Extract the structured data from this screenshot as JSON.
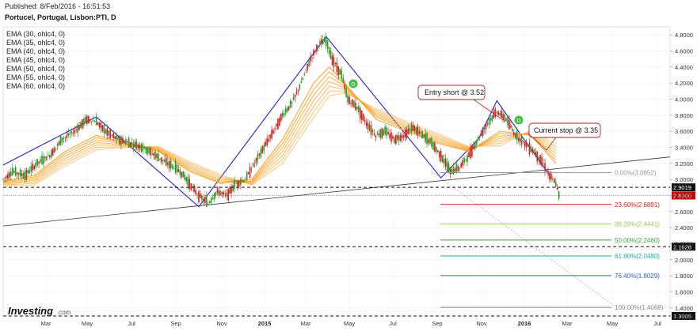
{
  "header": {
    "published": "Published: 8/Feb/2016 - 16:51:53",
    "instrument": "Portucel, Portugal, Lisbon:PTI, D"
  },
  "legend": [
    "EMA (30, ohlc4, 0)",
    "EMA (35, ohlc4, 0)",
    "EMA (40, ohlc4, 0)",
    "EMA (45, ohlc4, 0)",
    "EMA (50, ohlc4, 0)",
    "EMA (55, ohlc4, 0)",
    "EMA (60, ohlc4, 0)"
  ],
  "logo": {
    "main": "Investing",
    "suffix": ".com"
  },
  "colors": {
    "up_candle": "#2a9a2a",
    "down_candle": "#cc2222",
    "ema": "#f5a020",
    "trend_line": "#2222cc",
    "support_line": "#333333",
    "price_tag": "#cc0000",
    "level_tag": "#111111",
    "marker": "#44bb44"
  },
  "chart_data": {
    "type": "candlestick",
    "title": "Portucel, Portugal, Lisbon:PTI, D",
    "y_range": [
      1.3,
      4.9
    ],
    "y_ticks": [
      "4.8000",
      "4.6000",
      "4.4000",
      "4.2000",
      "4.0000",
      "3.8000",
      "3.6000",
      "3.4000",
      "3.2000",
      "3.0000",
      "2.8000",
      "2.6000",
      "2.4000",
      "2.2000",
      "2.0000",
      "1.8000",
      "1.6000",
      "1.4000",
      "1.3000"
    ],
    "x_ticks": [
      {
        "label": "Mar",
        "bold": false
      },
      {
        "label": "May",
        "bold": false
      },
      {
        "label": "Jul",
        "bold": false
      },
      {
        "label": "Sep",
        "bold": false
      },
      {
        "label": "Nov",
        "bold": false
      },
      {
        "label": "2015",
        "bold": true
      },
      {
        "label": "Mar",
        "bold": false
      },
      {
        "label": "May",
        "bold": false
      },
      {
        "label": "Jul",
        "bold": false
      },
      {
        "label": "Sep",
        "bold": false
      },
      {
        "label": "Nov",
        "bold": false
      },
      {
        "label": "2016",
        "bold": true
      },
      {
        "label": "Mar",
        "bold": false
      },
      {
        "label": "May",
        "bold": false
      },
      {
        "label": "Jul",
        "bold": false
      }
    ],
    "price_path": [
      [
        0,
        3.0
      ],
      [
        6,
        3.1
      ],
      [
        14,
        3.05
      ],
      [
        22,
        3.2
      ],
      [
        30,
        3.3
      ],
      [
        38,
        3.5
      ],
      [
        46,
        3.6
      ],
      [
        54,
        3.75
      ],
      [
        60,
        3.72
      ],
      [
        66,
        3.6
      ],
      [
        74,
        3.5
      ],
      [
        82,
        3.45
      ],
      [
        90,
        3.4
      ],
      [
        98,
        3.3
      ],
      [
        106,
        3.2
      ],
      [
        114,
        3.1
      ],
      [
        120,
        2.95
      ],
      [
        126,
        2.8
      ],
      [
        132,
        2.7
      ],
      [
        138,
        2.85
      ],
      [
        144,
        2.8
      ],
      [
        150,
        2.95
      ],
      [
        156,
        3.0
      ],
      [
        162,
        3.2
      ],
      [
        168,
        3.4
      ],
      [
        174,
        3.6
      ],
      [
        180,
        3.8
      ],
      [
        186,
        3.95
      ],
      [
        192,
        4.2
      ],
      [
        198,
        4.5
      ],
      [
        204,
        4.7
      ],
      [
        208,
        4.72
      ],
      [
        212,
        4.5
      ],
      [
        218,
        4.3
      ],
      [
        222,
        4.0
      ],
      [
        228,
        3.9
      ],
      [
        234,
        3.7
      ],
      [
        240,
        3.55
      ],
      [
        246,
        3.6
      ],
      [
        252,
        3.5
      ],
      [
        258,
        3.55
      ],
      [
        264,
        3.65
      ],
      [
        270,
        3.55
      ],
      [
        276,
        3.45
      ],
      [
        282,
        3.3
      ],
      [
        288,
        3.1
      ],
      [
        294,
        3.15
      ],
      [
        300,
        3.3
      ],
      [
        306,
        3.5
      ],
      [
        312,
        3.7
      ],
      [
        318,
        3.85
      ],
      [
        324,
        3.75
      ],
      [
        330,
        3.55
      ],
      [
        336,
        3.45
      ],
      [
        342,
        3.35
      ],
      [
        348,
        3.2
      ],
      [
        352,
        3.05
      ],
      [
        356,
        2.95
      ],
      [
        358,
        2.8
      ]
    ],
    "ema_series": [
      {
        "values": [
          [
            0,
            2.98
          ],
          [
            20,
            3.05
          ],
          [
            40,
            3.35
          ],
          [
            60,
            3.55
          ],
          [
            80,
            3.45
          ],
          [
            100,
            3.35
          ],
          [
            120,
            3.1
          ],
          [
            140,
            2.95
          ],
          [
            160,
            3.0
          ],
          [
            180,
            3.5
          ],
          [
            200,
            4.2
          ],
          [
            210,
            4.4
          ],
          [
            220,
            4.2
          ],
          [
            240,
            3.75
          ],
          [
            260,
            3.6
          ],
          [
            280,
            3.45
          ],
          [
            300,
            3.35
          ],
          [
            320,
            3.6
          ],
          [
            340,
            3.55
          ],
          [
            356,
            3.2
          ]
        ]
      },
      {
        "values": [
          [
            0,
            2.97
          ],
          [
            20,
            3.03
          ],
          [
            40,
            3.32
          ],
          [
            60,
            3.52
          ],
          [
            80,
            3.45
          ],
          [
            100,
            3.36
          ],
          [
            120,
            3.12
          ],
          [
            140,
            2.96
          ],
          [
            160,
            2.98
          ],
          [
            180,
            3.45
          ],
          [
            200,
            4.12
          ],
          [
            210,
            4.34
          ],
          [
            220,
            4.18
          ],
          [
            240,
            3.78
          ],
          [
            260,
            3.62
          ],
          [
            280,
            3.47
          ],
          [
            300,
            3.36
          ],
          [
            320,
            3.57
          ],
          [
            340,
            3.56
          ],
          [
            356,
            3.24
          ]
        ]
      },
      {
        "values": [
          [
            0,
            2.96
          ],
          [
            20,
            3.01
          ],
          [
            40,
            3.29
          ],
          [
            60,
            3.49
          ],
          [
            80,
            3.44
          ],
          [
            100,
            3.37
          ],
          [
            120,
            3.14
          ],
          [
            140,
            2.98
          ],
          [
            160,
            2.97
          ],
          [
            180,
            3.4
          ],
          [
            200,
            4.05
          ],
          [
            210,
            4.28
          ],
          [
            220,
            4.16
          ],
          [
            240,
            3.8
          ],
          [
            260,
            3.64
          ],
          [
            280,
            3.49
          ],
          [
            300,
            3.37
          ],
          [
            320,
            3.54
          ],
          [
            340,
            3.57
          ],
          [
            356,
            3.28
          ]
        ]
      },
      {
        "values": [
          [
            0,
            2.95
          ],
          [
            20,
            2.99
          ],
          [
            40,
            3.26
          ],
          [
            60,
            3.46
          ],
          [
            80,
            3.43
          ],
          [
            100,
            3.38
          ],
          [
            120,
            3.16
          ],
          [
            140,
            3.0
          ],
          [
            160,
            2.96
          ],
          [
            180,
            3.35
          ],
          [
            200,
            3.98
          ],
          [
            210,
            4.22
          ],
          [
            220,
            4.14
          ],
          [
            240,
            3.82
          ],
          [
            260,
            3.66
          ],
          [
            280,
            3.51
          ],
          [
            300,
            3.38
          ],
          [
            320,
            3.51
          ],
          [
            340,
            3.58
          ],
          [
            356,
            3.32
          ]
        ]
      },
      {
        "values": [
          [
            0,
            2.94
          ],
          [
            20,
            2.97
          ],
          [
            40,
            3.23
          ],
          [
            60,
            3.43
          ],
          [
            80,
            3.42
          ],
          [
            100,
            3.39
          ],
          [
            120,
            3.18
          ],
          [
            140,
            3.02
          ],
          [
            160,
            2.95
          ],
          [
            180,
            3.3
          ],
          [
            200,
            3.91
          ],
          [
            210,
            4.16
          ],
          [
            220,
            4.12
          ],
          [
            240,
            3.84
          ],
          [
            260,
            3.68
          ],
          [
            280,
            3.53
          ],
          [
            300,
            3.39
          ],
          [
            320,
            3.48
          ],
          [
            340,
            3.59
          ],
          [
            356,
            3.36
          ]
        ]
      },
      {
        "values": [
          [
            0,
            2.93
          ],
          [
            20,
            2.95
          ],
          [
            40,
            3.2
          ],
          [
            60,
            3.4
          ],
          [
            80,
            3.41
          ],
          [
            100,
            3.4
          ],
          [
            120,
            3.2
          ],
          [
            140,
            3.04
          ],
          [
            160,
            2.94
          ],
          [
            180,
            3.25
          ],
          [
            200,
            3.84
          ],
          [
            210,
            4.1
          ],
          [
            220,
            4.1
          ],
          [
            240,
            3.86
          ],
          [
            260,
            3.7
          ],
          [
            280,
            3.55
          ],
          [
            300,
            3.4
          ],
          [
            320,
            3.45
          ],
          [
            340,
            3.6
          ],
          [
            356,
            3.4
          ]
        ]
      },
      {
        "values": [
          [
            0,
            2.92
          ],
          [
            20,
            2.93
          ],
          [
            40,
            3.17
          ],
          [
            60,
            3.37
          ],
          [
            80,
            3.4
          ],
          [
            100,
            3.41
          ],
          [
            120,
            3.22
          ],
          [
            140,
            3.06
          ],
          [
            160,
            2.93
          ],
          [
            180,
            3.2
          ],
          [
            200,
            3.77
          ],
          [
            210,
            4.04
          ],
          [
            220,
            4.08
          ],
          [
            240,
            3.88
          ],
          [
            260,
            3.72
          ],
          [
            280,
            3.57
          ],
          [
            300,
            3.41
          ],
          [
            320,
            3.42
          ],
          [
            340,
            3.61
          ],
          [
            356,
            3.44
          ]
        ]
      }
    ],
    "annotations": {
      "entry_short": "Entry short @ 3.52",
      "current_stop": "Current stop  @ 3.35",
      "marker_1": "D",
      "marker_2": "D"
    },
    "price_tags": [
      {
        "value": 2.9019,
        "label": "2.9019",
        "color": "#111111"
      },
      {
        "value": 2.8,
        "label": "2.8000",
        "color": "#cc0000"
      },
      {
        "value": 2.1628,
        "label": "2.1628",
        "color": "#111111"
      },
      {
        "value": 1.3005,
        "label": "1.3005",
        "color": "#111111"
      }
    ],
    "fibonacci": [
      {
        "label": "0.00%(3.0852)",
        "value": 3.0852,
        "color": "#999999"
      },
      {
        "label": "23.60%(2.6891)",
        "value": 2.6891,
        "color": "#cc2222"
      },
      {
        "label": "38.20%(2.4441)",
        "value": 2.4441,
        "color": "#99cc44"
      },
      {
        "label": "50.00%(2.2460)",
        "value": 2.246,
        "color": "#33aa33"
      },
      {
        "label": "61.80%(2.0480)",
        "value": 2.048,
        "color": "#22aaaa"
      },
      {
        "label": "76.40%(1.8029)",
        "value": 1.8029,
        "color": "#3366cc"
      },
      {
        "label": "100.00%(1.4068)",
        "value": 1.4068,
        "color": "#888888"
      }
    ]
  }
}
